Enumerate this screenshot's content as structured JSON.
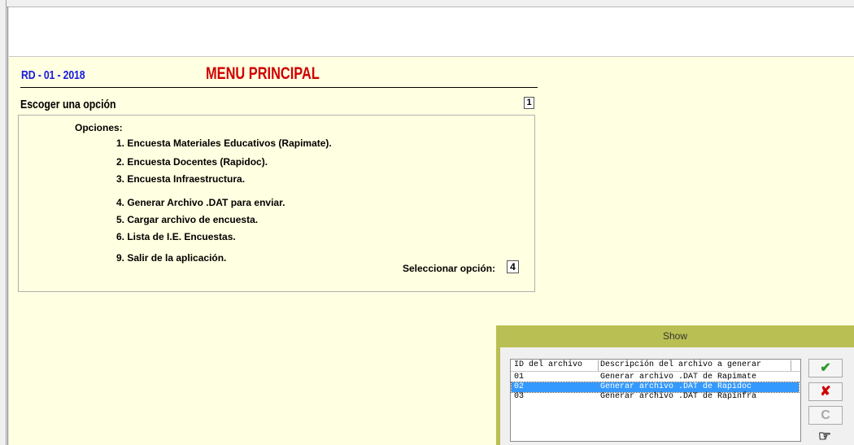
{
  "header": {
    "code": "RD - 01 - 2018",
    "title": "MENU PRINCIPAL",
    "subtitle": "Escoger una opción",
    "page_indicator": "1"
  },
  "menu": {
    "options_heading": "Opciones:",
    "items": [
      "1. Encuesta Materiales Educativos (Rapimate).",
      "2. Encuesta Docentes (Rapidoc).",
      "3. Encuesta Infraestructura.",
      "4. Generar Archivo .DAT para enviar.",
      "5. Cargar archivo de encuesta.",
      "6. Lista de I.E. Encuestas.",
      "9. Salir de la aplicación."
    ],
    "select_label": "Seleccionar opción:",
    "select_value": "4"
  },
  "dialog": {
    "title": "Show",
    "columns": [
      "ID del archivo",
      "Descripción del archivo a generar"
    ],
    "rows": [
      {
        "id": "01",
        "desc": "Generar archivo .DAT de Rapimate"
      },
      {
        "id": "02",
        "desc": "Generar archivo .DAT de Rapidoc"
      },
      {
        "id": "03",
        "desc": "Generar archivo .DAT de Rapinfra"
      }
    ],
    "selected_row": "02",
    "buttons": {
      "ok": "✔",
      "cancel": "✘",
      "retry": "C",
      "hand": "☞"
    }
  }
}
